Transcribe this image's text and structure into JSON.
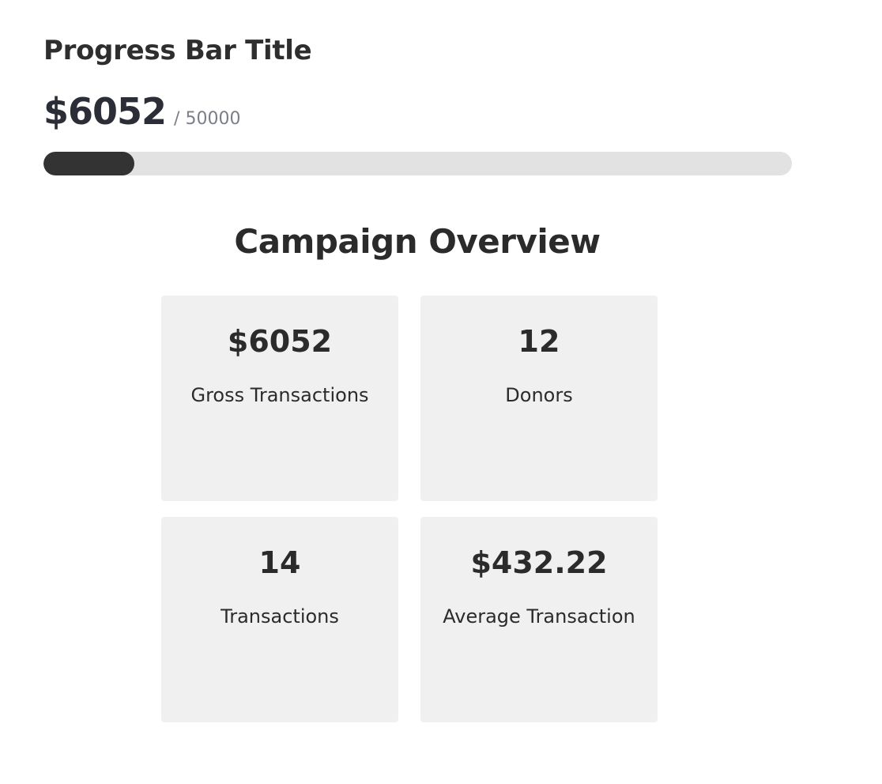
{
  "progress": {
    "title": "Progress Bar Title",
    "raised": "$6052",
    "goal": "/ 50000",
    "fraction": 0.12104,
    "colors": {
      "fill": "#333333",
      "track": "#e2e2e2"
    }
  },
  "overview": {
    "title": "Campaign Overview",
    "stats": [
      {
        "value": "$6052",
        "label": "Gross Transactions"
      },
      {
        "value": "12",
        "label": "Donors"
      },
      {
        "value": "14",
        "label": "Transactions"
      },
      {
        "value": "$432.22",
        "label": "Average Transaction"
      }
    ]
  }
}
